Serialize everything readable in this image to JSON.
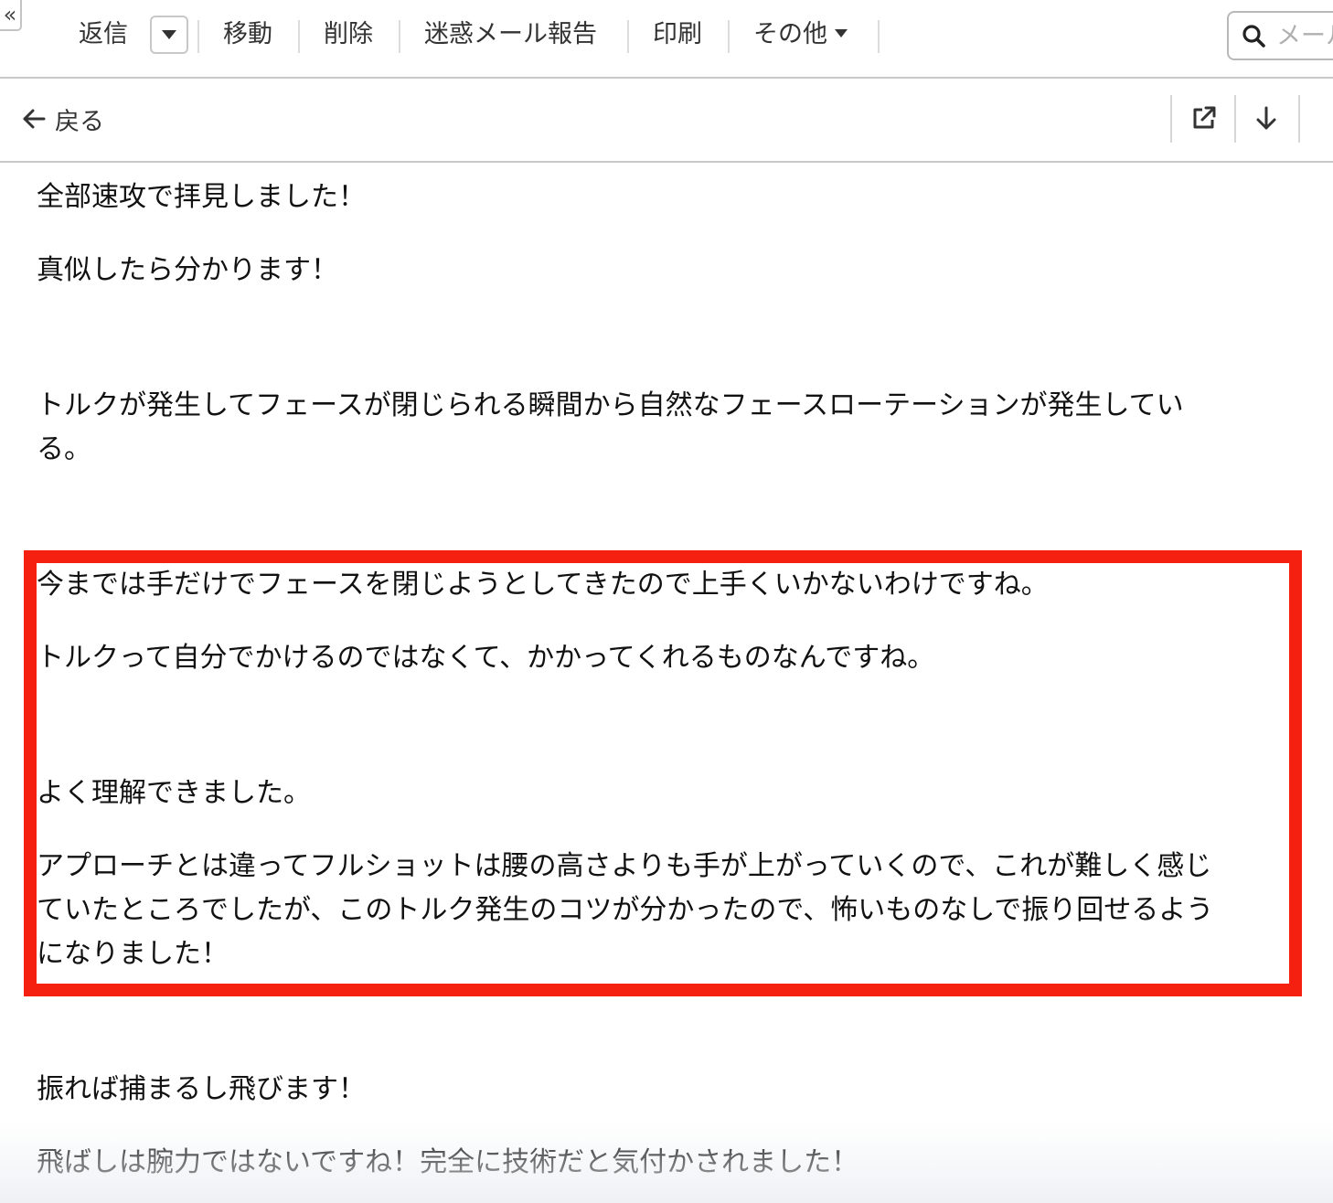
{
  "toolbar": {
    "collapse_glyph": "«",
    "reply_label": "返信",
    "move_label": "移動",
    "delete_label": "削除",
    "spam_label": "迷惑メール報告",
    "print_label": "印刷",
    "more_label": "その他",
    "search_placeholder": "メール"
  },
  "subbar": {
    "back_label": "戻る"
  },
  "message": {
    "lines": [
      "全部速攻で拝見しました！",
      "真似したら分かります！",
      "トルクが発生してフェースが閉じられる瞬間から自然なフェースローテーションが発生してい",
      "る。",
      "今までは手だけでフェースを閉じようとしてきたので上手くいかないわけですね。",
      "トルクって自分でかけるのではなくて、かかってくれるものなんですね。",
      "よく理解できました。",
      "アプローチとは違ってフルショットは腰の高さよりも手が上がっていくので、これが難しく感じ",
      "ていたところでしたが、このトルク発生のコツが分かったので、怖いものなしで振り回せるよう",
      "になりました！",
      "振れば捕まるし飛びます！",
      "飛ばしは腕力ではないですね！完全に技術だと気付かされました！"
    ]
  },
  "colors": {
    "highlight_border": "#f5200f",
    "divider": "#c9c9c9"
  },
  "icons": {
    "back": "arrow-left-icon",
    "open_new_window": "external-link-icon",
    "download": "arrow-down-icon",
    "search": "search-icon",
    "dropdown": "caret-down-icon"
  }
}
